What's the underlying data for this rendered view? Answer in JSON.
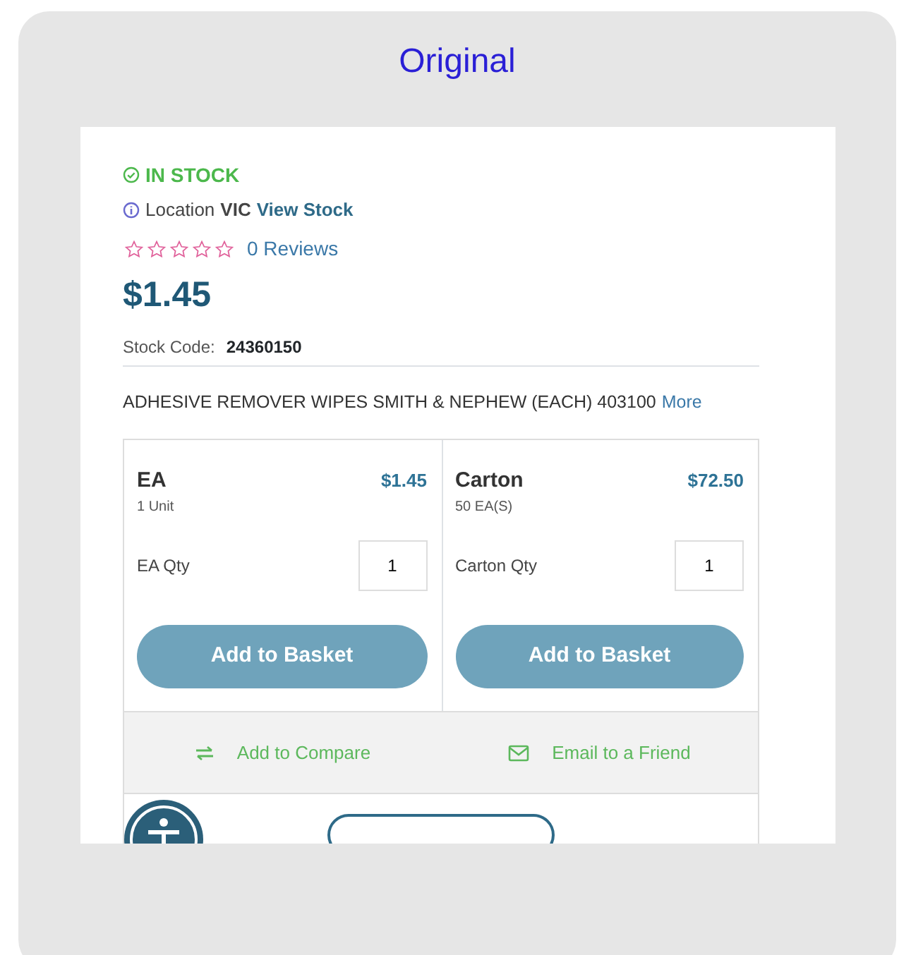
{
  "frame": {
    "title": "Original"
  },
  "stock": {
    "status": "IN STOCK",
    "location_label": "Location",
    "location": "VIC",
    "view_link": "View Stock"
  },
  "rating": {
    "stars": 0,
    "reviews": "0 Reviews"
  },
  "price": "$1.45",
  "stock_code": {
    "label": "Stock Code:",
    "value": "24360150"
  },
  "description": {
    "text": "ADHESIVE REMOVER WIPES SMITH & NEPHEW (EACH) 403100",
    "more": "More"
  },
  "options": [
    {
      "name": "EA",
      "price": "$1.45",
      "unit": "1 Unit",
      "qty_label": "EA Qty",
      "qty": "1",
      "button": "Add to Basket"
    },
    {
      "name": "Carton",
      "price": "$72.50",
      "unit": "50 EA(S)",
      "qty_label": "Carton Qty",
      "qty": "1",
      "button": "Add to Basket"
    }
  ],
  "actions": [
    {
      "kind": "compare",
      "label": "Add to Compare"
    },
    {
      "kind": "email",
      "label": "Email to a Friend"
    }
  ]
}
